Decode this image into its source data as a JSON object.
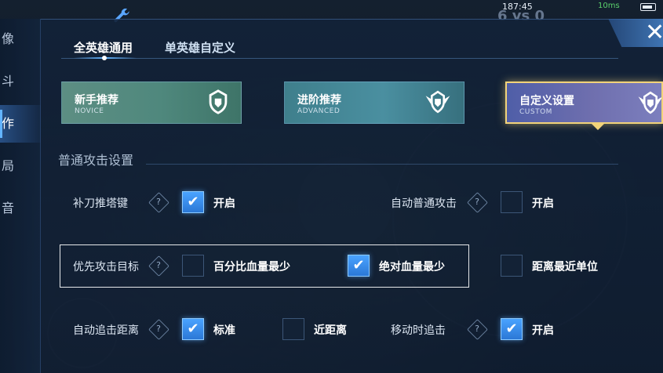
{
  "status": {
    "time": "187:45",
    "signal": "10ms",
    "score": "6 vs 0"
  },
  "side_nav": {
    "items": [
      {
        "label": "像"
      },
      {
        "label": "斗"
      },
      {
        "label": "作"
      },
      {
        "label": "局"
      },
      {
        "label": "音"
      }
    ]
  },
  "tabs": [
    {
      "label": "全英雄通用",
      "active": true
    },
    {
      "label": "单英雄自定义",
      "active": false
    }
  ],
  "presets": [
    {
      "title": "新手推荐",
      "subtitle": "NOVICE"
    },
    {
      "title": "进阶推荐",
      "subtitle": "ADVANCED"
    },
    {
      "title": "自定义设置",
      "subtitle": "CUSTOM"
    }
  ],
  "section": {
    "title": "普通攻击设置"
  },
  "settings": {
    "last_hit": {
      "label": "补刀推塔键",
      "option": "开启",
      "checked": true
    },
    "auto_attack": {
      "label": "自动普通攻击",
      "option": "开启",
      "checked": false
    },
    "priority": {
      "label": "优先攻击目标",
      "options": [
        {
          "label": "百分比血量最少",
          "checked": false
        },
        {
          "label": "绝对血量最少",
          "checked": true
        },
        {
          "label": "距离最近单位",
          "checked": false
        }
      ]
    },
    "chase_distance": {
      "label": "自动追击距离",
      "options": [
        {
          "label": "标准",
          "checked": true
        },
        {
          "label": "近距离",
          "checked": false
        }
      ]
    },
    "move_chase": {
      "label": "移动时追击",
      "option": "开启",
      "checked": true
    }
  },
  "icons": {
    "help_glyph": "?",
    "tick_glyph": "✔",
    "close_glyph": "✕"
  },
  "colors": {
    "accent": "#63b4ff",
    "selected_frame": "#f2d37a",
    "checkbox_on": "#3a8ef0"
  }
}
